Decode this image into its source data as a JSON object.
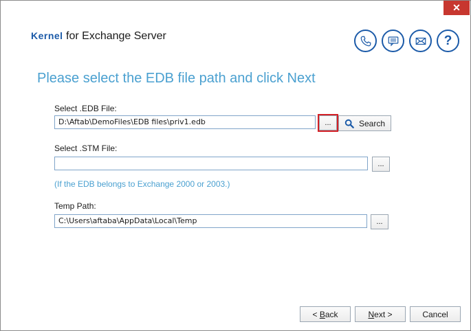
{
  "window": {
    "close_glyph": "✕"
  },
  "header": {
    "brand_kernel": "Kernel",
    "brand_rest": " for Exchange Server",
    "icons": [
      "phone-icon",
      "chat-icon",
      "mail-icon",
      "help-icon"
    ],
    "help_glyph": "?"
  },
  "page": {
    "heading": "Please select the EDB file path and click Next"
  },
  "edb": {
    "label": "Select .EDB File:",
    "value": "D:\\Aftab\\DemoFiles\\EDB files\\priv1.edb",
    "browse_label": "...",
    "search_label": "Search"
  },
  "stm": {
    "label": "Select .STM File:",
    "value": "",
    "browse_label": "...",
    "hint": "(If the EDB belongs to Exchange 2000 or 2003.)"
  },
  "temp": {
    "label": "Temp Path:",
    "value": "C:\\Users\\aftaba\\AppData\\Local\\Temp",
    "browse_label": "..."
  },
  "footer": {
    "back_prefix": "< ",
    "back_mnemonic": "B",
    "back_rest": "ack",
    "next_mnemonic": "N",
    "next_rest": "ext >",
    "cancel_label": "Cancel"
  },
  "colors": {
    "accent": "#1b5aa8",
    "heading": "#4aa0d0",
    "close": "#c7372f",
    "highlight": "#d42026"
  }
}
